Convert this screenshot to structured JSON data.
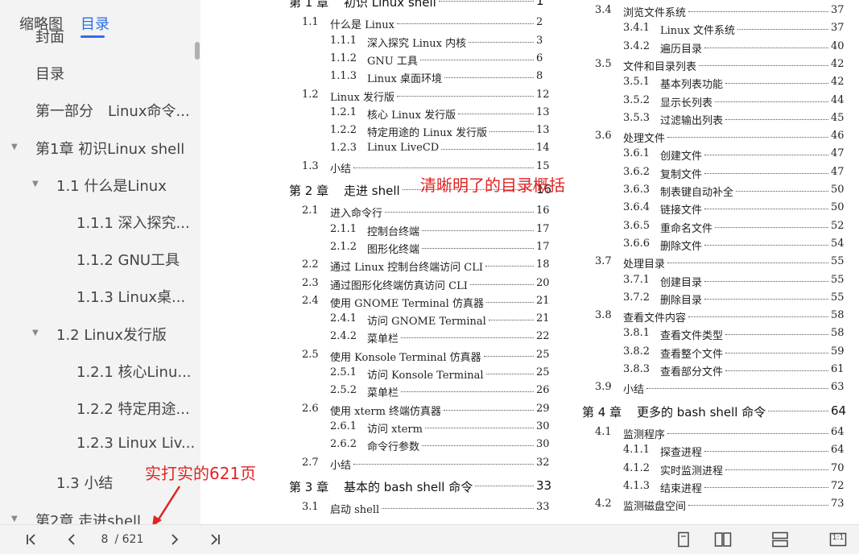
{
  "sidebar": {
    "tabs": [
      "缩略图",
      "目录"
    ],
    "items": [
      {
        "label": "封面",
        "level": 0
      },
      {
        "label": "目录",
        "level": 0
      },
      {
        "label": "第一部分　Linux命令...",
        "level": 0
      },
      {
        "label": "第1章 初识Linux shell",
        "level": 0,
        "expanded": true
      },
      {
        "label": "1.1 什么是Linux",
        "level": 1,
        "expanded": true
      },
      {
        "label": "1.1.1 深入探究...",
        "level": 2
      },
      {
        "label": "1.1.2 GNU工具",
        "level": 2
      },
      {
        "label": "1.1.3 Linux桌...",
        "level": 2
      },
      {
        "label": "1.2 Linux发行版",
        "level": 1,
        "expanded": true
      },
      {
        "label": "1.2.1 核心Linu...",
        "level": 2
      },
      {
        "label": "1.2.2 特定用途...",
        "level": 2
      },
      {
        "label": "1.2.3 Linux Liv...",
        "level": 2
      },
      {
        "label": "1.3 小结",
        "level": 1
      },
      {
        "label": "第2章 走进shell",
        "level": 0,
        "expanded": true
      }
    ]
  },
  "toc_left": [
    {
      "num": "第 1 章",
      "title": "初识 Linux shell",
      "page": "1",
      "kind": "chapter"
    },
    {
      "num": "1.1",
      "title": "什么是 Linux",
      "page": "2",
      "kind": "section"
    },
    {
      "num": "1.1.1",
      "title": "深入探究 Linux 内核",
      "page": "3",
      "kind": "sub"
    },
    {
      "num": "1.1.2",
      "title": "GNU 工具",
      "page": "6",
      "kind": "sub"
    },
    {
      "num": "1.1.3",
      "title": "Linux 桌面环境",
      "page": "8",
      "kind": "sub"
    },
    {
      "num": "1.2",
      "title": "Linux 发行版",
      "page": "12",
      "kind": "section"
    },
    {
      "num": "1.2.1",
      "title": "核心 Linux 发行版",
      "page": "13",
      "kind": "sub"
    },
    {
      "num": "1.2.2",
      "title": "特定用途的 Linux 发行版",
      "page": "13",
      "kind": "sub"
    },
    {
      "num": "1.2.3",
      "title": "Linux LiveCD",
      "page": "14",
      "kind": "sub"
    },
    {
      "num": "1.3",
      "title": "小结",
      "page": "15",
      "kind": "section"
    },
    {
      "num": "第 2 章",
      "title": "走进 shell",
      "page": "16",
      "kind": "chapter"
    },
    {
      "num": "2.1",
      "title": "进入命令行",
      "page": "16",
      "kind": "section"
    },
    {
      "num": "2.1.1",
      "title": "控制台终端",
      "page": "17",
      "kind": "sub"
    },
    {
      "num": "2.1.2",
      "title": "图形化终端",
      "page": "17",
      "kind": "sub"
    },
    {
      "num": "2.2",
      "title": "通过 Linux 控制台终端访问 CLI",
      "page": "18",
      "kind": "section"
    },
    {
      "num": "2.3",
      "title": "通过图形化终端仿真访问 CLI",
      "page": "20",
      "kind": "section"
    },
    {
      "num": "2.4",
      "title": "使用 GNOME Terminal 仿真器",
      "page": "21",
      "kind": "section"
    },
    {
      "num": "2.4.1",
      "title": "访问 GNOME Terminal",
      "page": "21",
      "kind": "sub"
    },
    {
      "num": "2.4.2",
      "title": "菜单栏",
      "page": "22",
      "kind": "sub"
    },
    {
      "num": "2.5",
      "title": "使用 Konsole Terminal 仿真器",
      "page": "25",
      "kind": "section"
    },
    {
      "num": "2.5.1",
      "title": "访问 Konsole Terminal",
      "page": "25",
      "kind": "sub"
    },
    {
      "num": "2.5.2",
      "title": "菜单栏",
      "page": "26",
      "kind": "sub"
    },
    {
      "num": "2.6",
      "title": "使用 xterm 终端仿真器",
      "page": "29",
      "kind": "section"
    },
    {
      "num": "2.6.1",
      "title": "访问 xterm",
      "page": "30",
      "kind": "sub"
    },
    {
      "num": "2.6.2",
      "title": "命令行参数",
      "page": "30",
      "kind": "sub"
    },
    {
      "num": "2.7",
      "title": "小结",
      "page": "32",
      "kind": "section"
    },
    {
      "num": "第 3 章",
      "title": "基本的 bash shell 命令",
      "page": "33",
      "kind": "chapter"
    },
    {
      "num": "3.1",
      "title": "启动 shell",
      "page": "33",
      "kind": "section"
    }
  ],
  "toc_right": [
    {
      "num": "3.4",
      "title": "浏览文件系统",
      "page": "37",
      "kind": "section"
    },
    {
      "num": "3.4.1",
      "title": "Linux 文件系统",
      "page": "37",
      "kind": "sub"
    },
    {
      "num": "3.4.2",
      "title": "遍历目录",
      "page": "40",
      "kind": "sub"
    },
    {
      "num": "3.5",
      "title": "文件和目录列表",
      "page": "42",
      "kind": "section"
    },
    {
      "num": "3.5.1",
      "title": "基本列表功能",
      "page": "42",
      "kind": "sub"
    },
    {
      "num": "3.5.2",
      "title": "显示长列表",
      "page": "44",
      "kind": "sub"
    },
    {
      "num": "3.5.3",
      "title": "过滤输出列表",
      "page": "45",
      "kind": "sub"
    },
    {
      "num": "3.6",
      "title": "处理文件",
      "page": "46",
      "kind": "section"
    },
    {
      "num": "3.6.1",
      "title": "创建文件",
      "page": "47",
      "kind": "sub"
    },
    {
      "num": "3.6.2",
      "title": "复制文件",
      "page": "47",
      "kind": "sub"
    },
    {
      "num": "3.6.3",
      "title": "制表键自动补全",
      "page": "50",
      "kind": "sub"
    },
    {
      "num": "3.6.4",
      "title": "链接文件",
      "page": "50",
      "kind": "sub"
    },
    {
      "num": "3.6.5",
      "title": "重命名文件",
      "page": "52",
      "kind": "sub"
    },
    {
      "num": "3.6.6",
      "title": "删除文件",
      "page": "54",
      "kind": "sub"
    },
    {
      "num": "3.7",
      "title": "处理目录",
      "page": "55",
      "kind": "section"
    },
    {
      "num": "3.7.1",
      "title": "创建目录",
      "page": "55",
      "kind": "sub"
    },
    {
      "num": "3.7.2",
      "title": "删除目录",
      "page": "55",
      "kind": "sub"
    },
    {
      "num": "3.8",
      "title": "查看文件内容",
      "page": "58",
      "kind": "section"
    },
    {
      "num": "3.8.1",
      "title": "查看文件类型",
      "page": "58",
      "kind": "sub"
    },
    {
      "num": "3.8.2",
      "title": "查看整个文件",
      "page": "59",
      "kind": "sub"
    },
    {
      "num": "3.8.3",
      "title": "查看部分文件",
      "page": "61",
      "kind": "sub"
    },
    {
      "num": "3.9",
      "title": "小结",
      "page": "63",
      "kind": "section"
    },
    {
      "num": "第 4 章",
      "title": "更多的 bash shell 命令",
      "page": "64",
      "kind": "chapter"
    },
    {
      "num": "4.1",
      "title": "监测程序",
      "page": "64",
      "kind": "section"
    },
    {
      "num": "4.1.1",
      "title": "探查进程",
      "page": "64",
      "kind": "sub"
    },
    {
      "num": "4.1.2",
      "title": "实时监测进程",
      "page": "70",
      "kind": "sub"
    },
    {
      "num": "4.1.3",
      "title": "结束进程",
      "page": "72",
      "kind": "sub"
    },
    {
      "num": "4.2",
      "title": "监测磁盘空间",
      "page": "73",
      "kind": "section"
    }
  ],
  "annotations": {
    "toc_note": "清晰明了的目录概括",
    "pages_note": "实打实的621页"
  },
  "toolbar": {
    "current_page": "8",
    "page_separator": "/",
    "total_pages": "621",
    "fit_label": "1:1"
  },
  "colors": {
    "accent": "#2e6ee6",
    "annotation": "#e02424"
  }
}
